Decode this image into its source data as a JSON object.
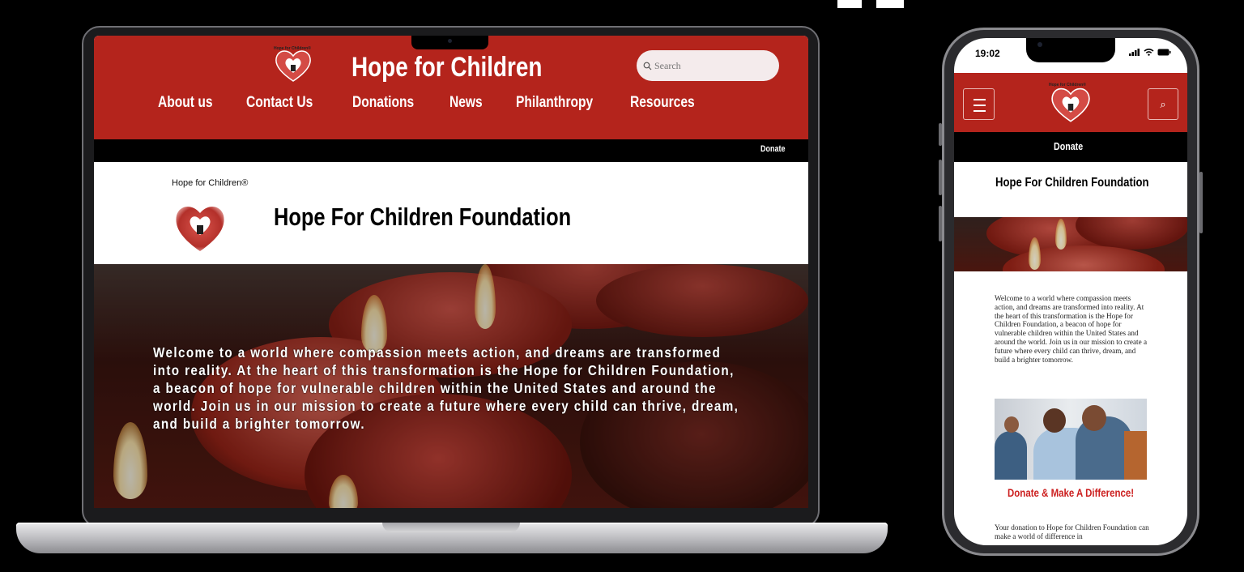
{
  "laptop": {
    "logo_text": "Hope for Children®",
    "site_title": "Hope for Children",
    "search_placeholder": "Search",
    "nav": [
      "About us",
      "Contact Us",
      "Donations",
      "News",
      "Philanthropy",
      "Resources"
    ],
    "donate_link": "Donate",
    "brand_label": "Hope for Children®",
    "heading": "Hope For Children Foundation",
    "hero_text": "Welcome to a world where compassion meets action, and dreams are transformed into reality. At the heart of this transformation is the Hope for Children Foundation, a beacon of hope for vulnerable children within the United States and around the world. Join us in our mission to create a future where every child can thrive, dream, and build a brighter tomorrow."
  },
  "phone": {
    "time": "19:02",
    "status": "▂▄▆ ◠ ▬",
    "logo_text": "Hope for Children®",
    "search_icon": "⌕",
    "donate_link": "Donate",
    "heading": "Hope For Children Foundation",
    "intro": "Welcome to a world where compassion meets action, and dreams are transformed into reality. At the heart of this transformation is the Hope for Children Foundation, a beacon of hope for vulnerable children within the United States and around the world. Join us in our mission to create a future where every child can thrive, dream, and build a brighter tomorrow.",
    "cta": "Donate & Make A Difference!",
    "donation_text": "Your donation to Hope for Children Foundation can make a world of difference in"
  },
  "colors": {
    "brand_red": "#b4241c",
    "cta_red": "#cc1f1f",
    "bar_black": "#000000",
    "search_bg": "#f4ebec"
  },
  "icons": [
    "heart-logo-icon",
    "search-icon",
    "hamburger-menu-icon",
    "signal-icon",
    "wifi-icon",
    "battery-icon"
  ]
}
